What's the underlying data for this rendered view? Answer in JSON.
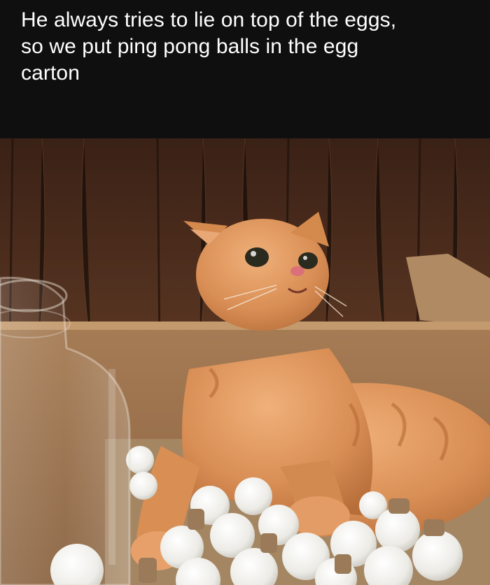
{
  "post": {
    "caption_lines": [
      "He always tries to lie on top of the eggs,",
      "so we put ping pong balls in the egg",
      "carton"
    ]
  },
  "photo": {
    "subject_icons": [
      "cat-icon",
      "ping-pong-ball-icon",
      "egg-carton-icon",
      "glass-jar-icon"
    ],
    "colors": {
      "background": "#0f0f10",
      "wood": "#4a2c1c",
      "cardboard": "#a9825a",
      "cat_fur": "#d9925a",
      "ball": "#f3f1ec"
    }
  }
}
